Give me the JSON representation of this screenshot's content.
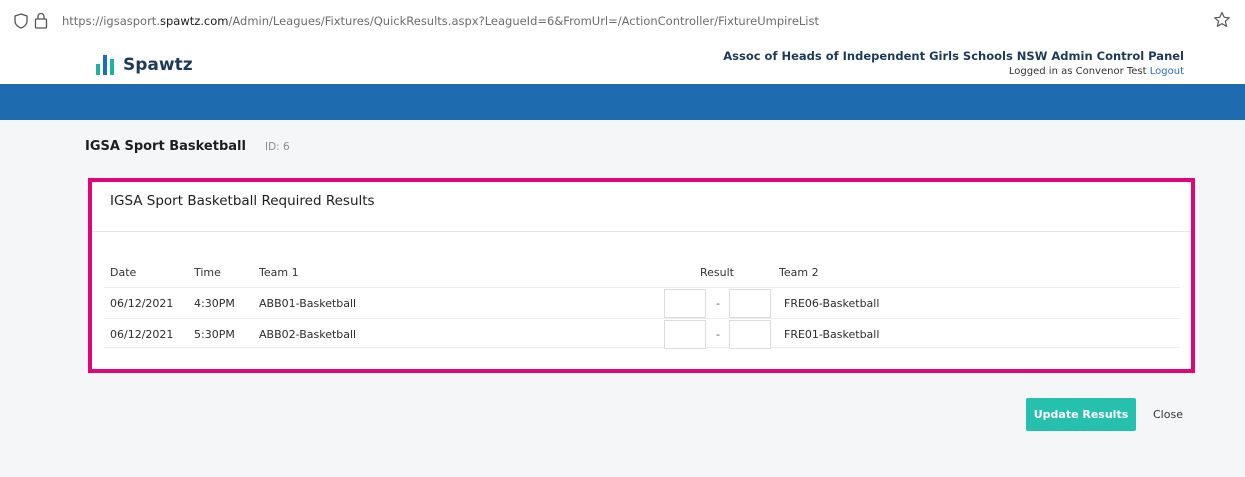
{
  "browser": {
    "url_prefix": "https://igsasport.",
    "url_domain": "spawtz.com",
    "url_suffix": "/Admin/Leagues/Fixtures/QuickResults.aspx?LeagueId=6&FromUrl=/ActionController/FixtureUmpireList"
  },
  "header": {
    "logo_text": "Spawtz",
    "org_title": "Assoc of Heads of Independent Girls Schools NSW Admin Control Panel",
    "logged_in_text": "Logged in as Convenor Test",
    "logout_label": "Logout"
  },
  "page": {
    "title": "IGSA Sport Basketball",
    "id_label": "ID: 6"
  },
  "card": {
    "title": "IGSA Sport Basketball Required Results"
  },
  "table": {
    "headers": {
      "date": "Date",
      "time": "Time",
      "team1": "Team 1",
      "result": "Result",
      "team2": "Team 2"
    },
    "rows": [
      {
        "date": "06/12/2021",
        "time": "4:30PM",
        "team1": "ABB01-Basketball",
        "score1": "",
        "separator": "-",
        "score2": "",
        "team2": "FRE06-Basketball"
      },
      {
        "date": "06/12/2021",
        "time": "5:30PM",
        "team1": "ABB02-Basketball",
        "score1": "",
        "separator": "-",
        "score2": "",
        "team2": "FRE01-Basketball"
      }
    ]
  },
  "actions": {
    "update_label": "Update Results",
    "close_label": "Close"
  },
  "colors": {
    "brand_blue": "#1e6bb0",
    "highlight_border": "#e4047a",
    "update_button": "#27bfae",
    "logo_teal": "#1ab59c"
  }
}
